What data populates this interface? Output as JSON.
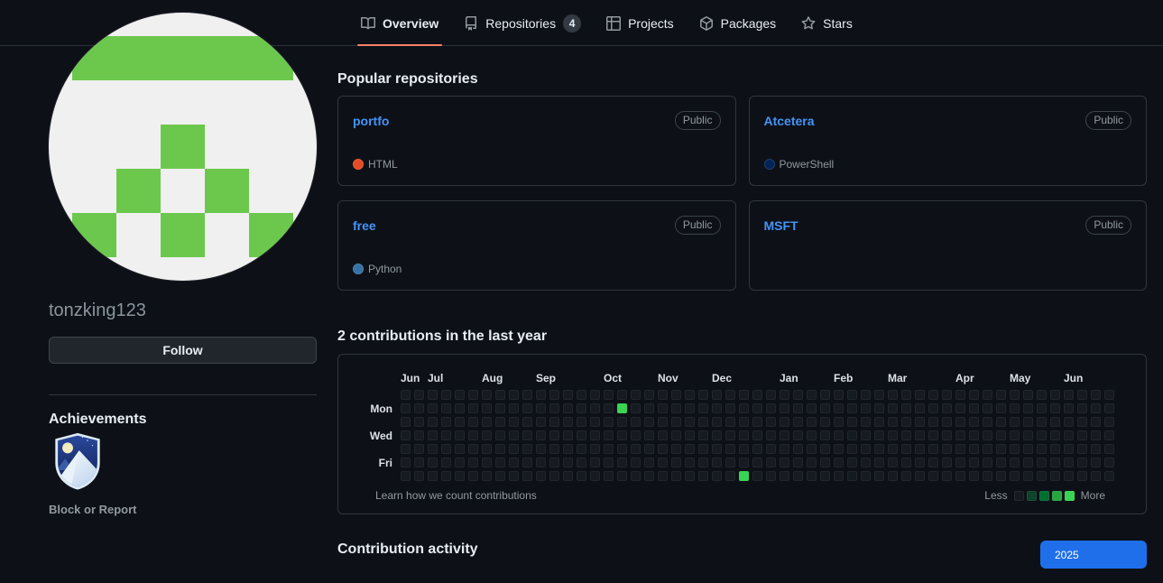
{
  "nav": {
    "tabs": [
      {
        "label": "Overview",
        "icon": "book-icon",
        "active": true
      },
      {
        "label": "Repositories",
        "icon": "repo-icon",
        "count": "4"
      },
      {
        "label": "Projects",
        "icon": "project-icon"
      },
      {
        "label": "Packages",
        "icon": "package-icon"
      },
      {
        "label": "Stars",
        "icon": "star-icon"
      }
    ],
    "active_underline_color": "#f78166"
  },
  "profile": {
    "username": "tonzking123",
    "follow_label": "Follow",
    "achievements_title": "Achievements",
    "block_report_label": "Block or Report",
    "avatar": {
      "type": "identicon",
      "background": "#f0f0f0",
      "color": "#6cc84d",
      "pattern": [
        [
          1,
          1,
          1,
          1,
          1
        ],
        [
          0,
          0,
          0,
          0,
          0
        ],
        [
          0,
          0,
          1,
          0,
          0
        ],
        [
          0,
          1,
          0,
          1,
          0
        ],
        [
          1,
          0,
          1,
          0,
          1
        ]
      ]
    }
  },
  "popular": {
    "title": "Popular repositories",
    "repos": [
      {
        "name": "portfo",
        "visibility": "Public",
        "language": "HTML",
        "language_color": "#e34c26"
      },
      {
        "name": "Atcetera",
        "visibility": "Public",
        "language": "PowerShell",
        "language_color": "#012456"
      },
      {
        "name": "free",
        "visibility": "Public",
        "language": "Python",
        "language_color": "#3572A5"
      },
      {
        "name": "MSFT",
        "visibility": "Public",
        "language": null,
        "language_color": null
      }
    ]
  },
  "contributions": {
    "title": "2 contributions in the last year",
    "learn_link": "Learn how we count contributions",
    "legend": {
      "less_label": "Less",
      "more_label": "More",
      "colors": [
        "#161b22",
        "#0e4429",
        "#006d32",
        "#26a641",
        "#39d353"
      ]
    },
    "calendar": {
      "weeks": 53,
      "days": 7,
      "empty_color": "#161b22",
      "filled_color": "#39d353",
      "month_labels": [
        {
          "label": "Jun",
          "week": 0
        },
        {
          "label": "Jul",
          "week": 2
        },
        {
          "label": "Aug",
          "week": 6
        },
        {
          "label": "Sep",
          "week": 10
        },
        {
          "label": "Oct",
          "week": 15
        },
        {
          "label": "Nov",
          "week": 19
        },
        {
          "label": "Dec",
          "week": 23
        },
        {
          "label": "Jan",
          "week": 28
        },
        {
          "label": "Feb",
          "week": 32
        },
        {
          "label": "Mar",
          "week": 36
        },
        {
          "label": "Apr",
          "week": 41
        },
        {
          "label": "May",
          "week": 45
        },
        {
          "label": "Jun",
          "week": 49
        }
      ],
      "day_labels": [
        {
          "label": "Mon",
          "row": 1
        },
        {
          "label": "Wed",
          "row": 3
        },
        {
          "label": "Fri",
          "row": 5
        }
      ],
      "filled_cells": [
        {
          "week": 16,
          "day": 1,
          "count": 1
        },
        {
          "week": 25,
          "day": 6,
          "count": 1
        }
      ]
    }
  },
  "activity": {
    "title": "Contribution activity",
    "year_label": "2025",
    "year_button_color": "#1f6feb"
  }
}
